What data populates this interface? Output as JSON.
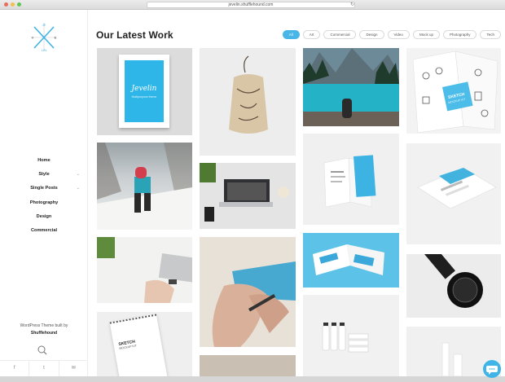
{
  "browser": {
    "url": "jevelin.shufflehound.com",
    "reload_icon": "reload-icon"
  },
  "sidebar": {
    "nav": [
      {
        "label": "Home",
        "has_submenu": false
      },
      {
        "label": "Style",
        "has_submenu": true
      },
      {
        "label": "Single Posts",
        "has_submenu": true
      },
      {
        "label": "Photography",
        "has_submenu": false
      },
      {
        "label": "Design",
        "has_submenu": false
      },
      {
        "label": "Commercial",
        "has_submenu": false
      }
    ],
    "credit_line1": "WordPress Theme built by",
    "credit_line2": "Shufflehound",
    "logo_letters": [
      "JE",
      "V",
      "E",
      "LIN"
    ]
  },
  "main": {
    "title_light": "Our",
    "title_bold": "Latest Work",
    "filters": [
      "All",
      "Art",
      "Commercial",
      "Design",
      "Video",
      "Mock up",
      "Photography",
      "Tech"
    ],
    "active_filter": "All"
  },
  "portfolio": {
    "poster_brand": "Jevelin",
    "poster_tagline": "Multipurpose theme",
    "brochure_title": "SKETCH",
    "brochure_subtitle": "MOCKUP KIT",
    "notebook_title": "SKETCH",
    "notebook_subtitle": "MOCKUP KIT"
  },
  "colors": {
    "accent": "#48b6e6",
    "chat": "#3fb4e6"
  }
}
